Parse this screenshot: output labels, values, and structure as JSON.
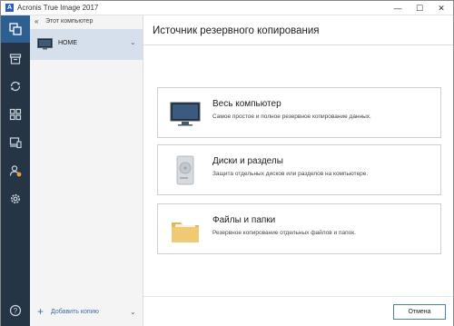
{
  "window": {
    "title": "Acronis True Image 2017",
    "logo_letter": "A",
    "controls": {
      "minimize": "—",
      "maximize": "☐",
      "close": "✕"
    }
  },
  "rail": {
    "items": [
      {
        "icon": "backup-icon",
        "active": true
      },
      {
        "icon": "archive-icon",
        "active": false
      },
      {
        "icon": "sync-icon",
        "active": false
      },
      {
        "icon": "tools-grid-icon",
        "active": false
      },
      {
        "icon": "devices-icon",
        "active": false
      },
      {
        "icon": "account-icon",
        "active": false
      },
      {
        "icon": "settings-icon",
        "active": false
      },
      {
        "icon": "help-icon",
        "active": false
      }
    ]
  },
  "sources": {
    "header": "Этот компьютер",
    "header_chevron": "«",
    "selected_item": "HOME",
    "item_chevron": "⌄",
    "add_label": "Добавить копию",
    "add_plus": "+",
    "add_chevron": "⌄"
  },
  "main": {
    "title": "Источник резервного копирования",
    "cards": [
      {
        "title": "Весь компьютер",
        "description": "Самое простое и полное резервное копирование данных.",
        "icon": "monitor-icon"
      },
      {
        "title": "Диски и разделы",
        "description": "Защита отдельных дисков или разделов на компьютере.",
        "icon": "hard-drive-icon"
      },
      {
        "title": "Файлы и папки",
        "description": "Резервное копирование отдельных файлов и папок.",
        "icon": "folder-icon"
      }
    ],
    "cancel_label": "Отмена"
  },
  "colors": {
    "rail_bg": "#253545",
    "rail_active": "#2e5f93",
    "accent": "#3d6ea6",
    "selected_item_bg": "#d5e0ec",
    "account_badge": "#e8a23a"
  }
}
